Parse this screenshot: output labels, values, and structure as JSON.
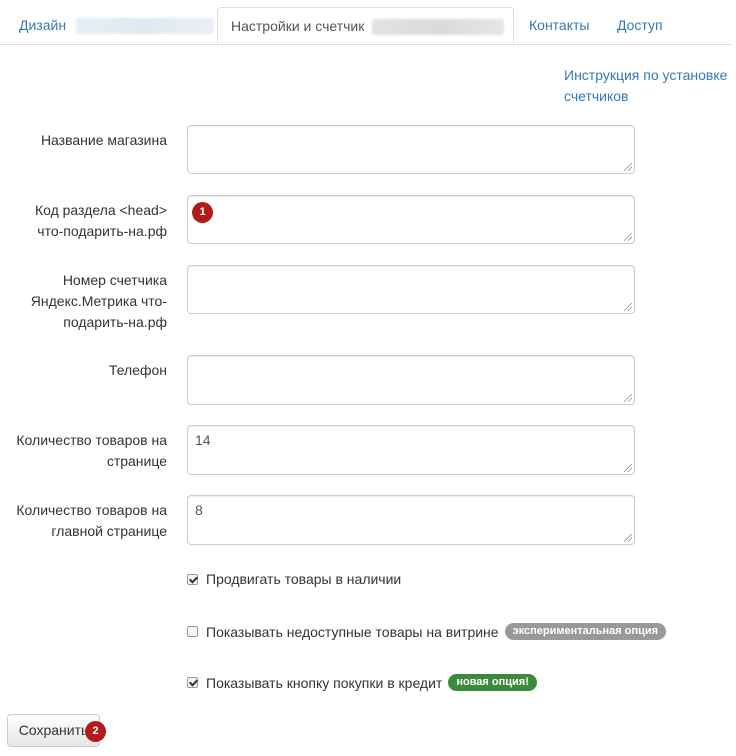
{
  "tabs": [
    {
      "label": "Дизайн",
      "active": false
    },
    {
      "label": "Настройки и счетчик",
      "active": true
    },
    {
      "label": "Контакты",
      "active": false
    },
    {
      "label": "Доступ",
      "active": false
    }
  ],
  "help_link": "Инструкция по установке счетчиков",
  "fields": {
    "shop_name": {
      "label": "Название магазина",
      "value": ""
    },
    "head_code": {
      "label": "Код раздела <head> что-подарить-на.рф",
      "value": ""
    },
    "metrika": {
      "label": "Номер счетчика Яндекс.Метрика что-подарить-на.рф",
      "value": ""
    },
    "phone": {
      "label": "Телефон",
      "value": ""
    },
    "per_page": {
      "label": "Количество товаров на странице",
      "value": "14"
    },
    "per_main": {
      "label": "Количество товаров на главной странице",
      "value": "8"
    }
  },
  "checks": {
    "promote": {
      "label": "Продвигать товары в наличии",
      "checked": true
    },
    "unavailable": {
      "label": "Показывать недоступные товары на витрине",
      "checked": false,
      "badge": "экспериментальная опция",
      "badge_color": "#999999"
    },
    "credit": {
      "label": "Показывать кнопку покупки в кредит",
      "checked": true,
      "badge": "новая опция!",
      "badge_color": "#3c8a3c"
    }
  },
  "save_label": "Сохранить",
  "markers": [
    "1",
    "2"
  ],
  "colors": {
    "link": "#337ab7",
    "marker": "#b31b1b"
  }
}
